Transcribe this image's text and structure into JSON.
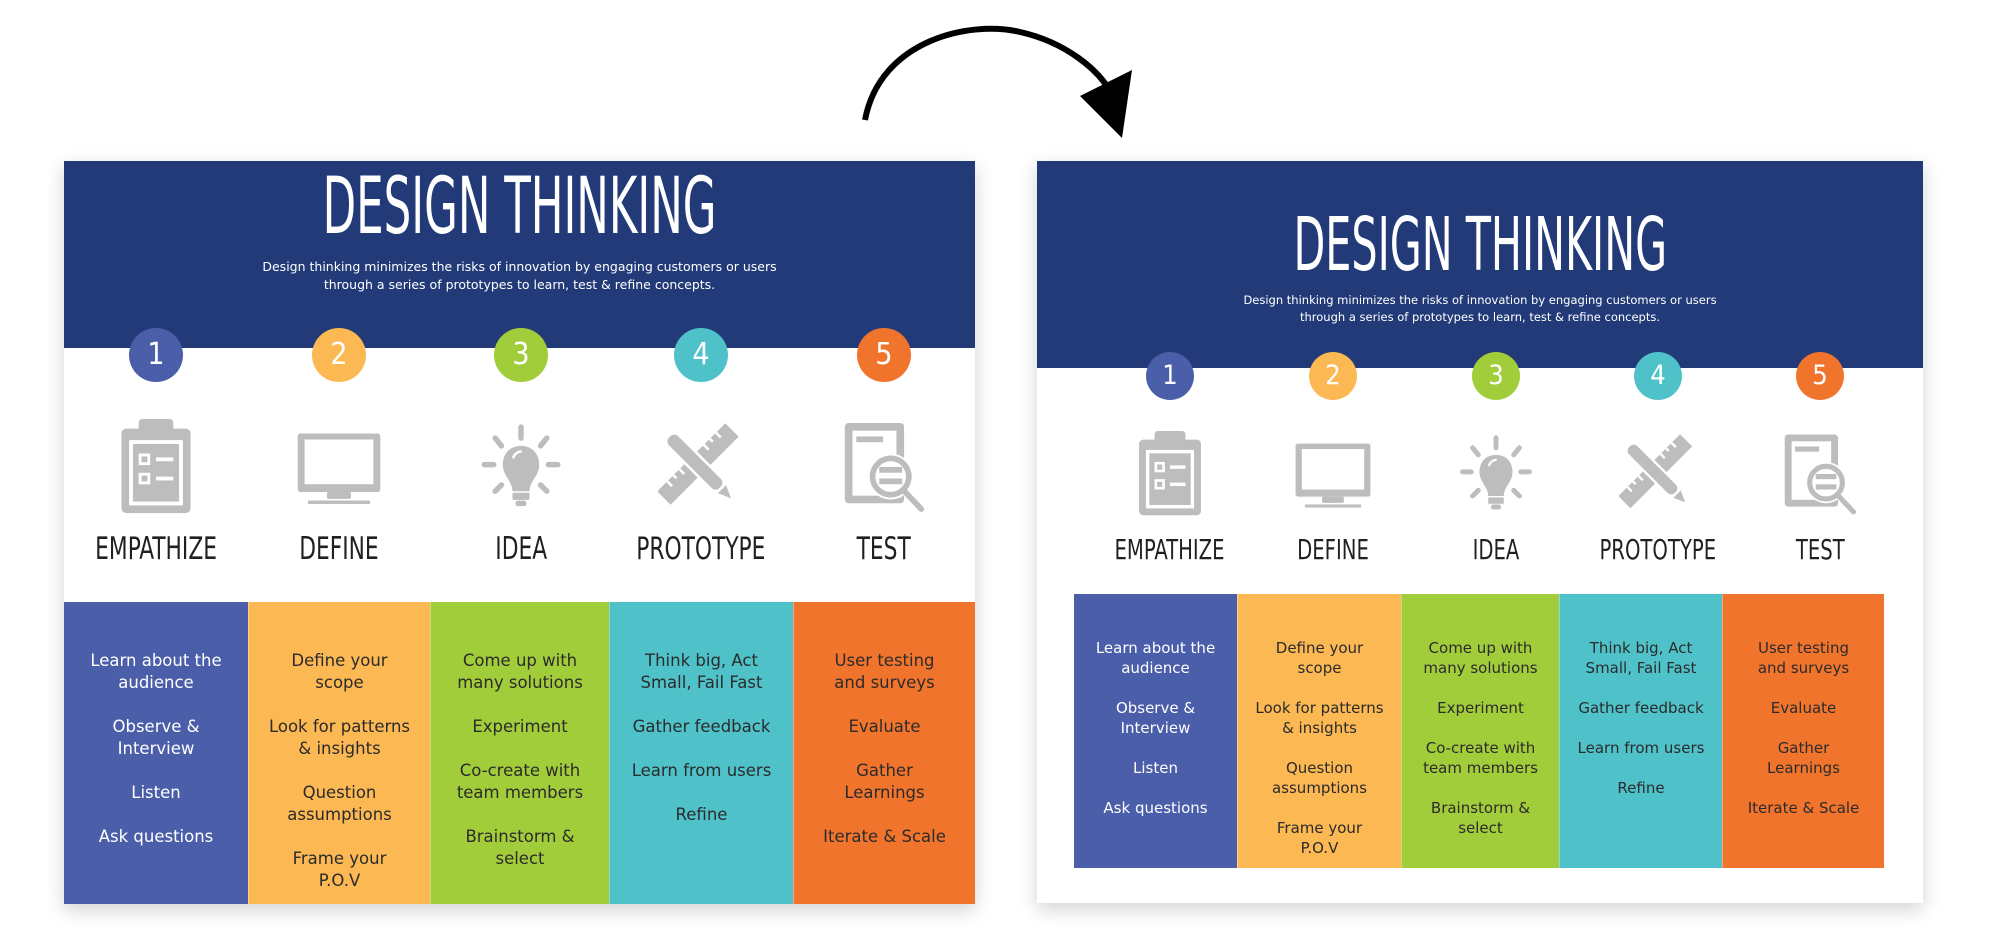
{
  "colors": {
    "header": "#223B78",
    "steps": [
      "#4B5EA9",
      "#FBB853",
      "#A2CD3A",
      "#4FC2C9",
      "#F1742C"
    ],
    "icon_gray": "#BDBDBD",
    "label_dark": "#231F20"
  },
  "arrow": {
    "icon": "curved-arrow-right-icon",
    "color": "#000000"
  },
  "infographic": {
    "title": "DESIGN THINKING",
    "subtitle_line1": "Design thinking minimizes the risks of innovation by engaging customers or users",
    "subtitle_line2": "through a series of prototypes to learn, test & refine concepts.",
    "steps": [
      {
        "number": "1",
        "label": "EMPATHIZE",
        "icon": "clipboard-checklist-icon",
        "items": [
          "Learn about the\naudience",
          "Observe &\nInterview",
          "Listen",
          "Ask questions"
        ]
      },
      {
        "number": "2",
        "label": "DEFINE",
        "icon": "monitor-icon",
        "items": [
          "Define your\nscope",
          "Look for patterns\n& insights",
          "Question\nassumptions",
          "Frame your\nP.O.V"
        ]
      },
      {
        "number": "3",
        "label": "IDEA",
        "icon": "lightbulb-icon",
        "items": [
          "Come up with\nmany solutions",
          "Experiment",
          "Co-create with\nteam members",
          "Brainstorm &\nselect"
        ]
      },
      {
        "number": "4",
        "label": "PROTOTYPE",
        "icon": "ruler-pencil-icon",
        "items": [
          "Think big, Act\nSmall, Fail Fast",
          "Gather feedback",
          "Learn from users",
          "Refine"
        ]
      },
      {
        "number": "5",
        "label": "TEST",
        "icon": "document-magnifier-icon",
        "items": [
          "User testing\nand surveys",
          "Evaluate",
          "Gather\nLearnings",
          "Iterate & Scale"
        ]
      }
    ]
  },
  "panels": [
    {
      "name": "original-infographic"
    },
    {
      "name": "revised-infographic"
    }
  ]
}
